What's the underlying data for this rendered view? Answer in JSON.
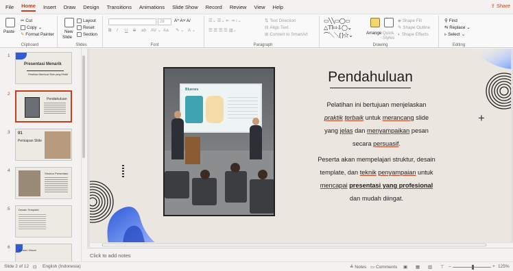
{
  "menu": {
    "items": [
      "File",
      "Home",
      "Insert",
      "Draw",
      "Design",
      "Transitions",
      "Animations",
      "Slide Show",
      "Record",
      "Review",
      "View",
      "Help"
    ],
    "active": "Home",
    "share": "Share"
  },
  "ribbon": {
    "clipboard": {
      "paste": "Paste",
      "cut": "Cut",
      "copy": "Copy",
      "format_painter": "Format Painter",
      "label": "Clipboard"
    },
    "slides": {
      "new_slide": "New",
      "new_slide2": "Slide",
      "layout": "Layout",
      "reset": "Reset",
      "section": "Section",
      "label": "Slides"
    },
    "font": {
      "size": "28",
      "label": "Font",
      "bold": "B",
      "italic": "I",
      "underline": "U",
      "strike": "S",
      "abc": "ab",
      "aa": "Aa"
    },
    "paragraph": {
      "text_direction": "Text Direction",
      "align_text": "Align Text",
      "smartart": "Convert to SmartArt",
      "label": "Paragraph"
    },
    "drawing": {
      "arrange": "Arrange",
      "quick_styles": "Quick",
      "quick_styles2": "Styles",
      "shape_fill": "Shape Fill",
      "shape_outline": "Shape Outline",
      "shape_effects": "Shape Effects",
      "label": "Drawing"
    },
    "editing": {
      "find": "Find",
      "replace": "Replace",
      "select": "Select",
      "label": "Editing"
    }
  },
  "thumbnails": [
    {
      "num": "1",
      "title": "Presentasi Menarik",
      "subtitle": "Pelatihan Membuat Slide yang Efektif"
    },
    {
      "num": "2",
      "title": "Pendahuluan",
      "selected": true
    },
    {
      "num": "3",
      "title": "Persiapan Slide",
      "tag": "01"
    },
    {
      "num": "4",
      "title": "Struktur Presentasi"
    },
    {
      "num": "5",
      "title": "Desain Template"
    },
    {
      "num": "6",
      "title": "Elemen Visual"
    }
  ],
  "slide": {
    "title": "Pendahuluan",
    "para1": {
      "part1": "Pelatihan ini bertujuan menjelaskan",
      "w_praktik": "praktik",
      "w_terbaik": "terbaik",
      "part2": "untuk",
      "w_merancang": "merancang",
      "part3": "slide",
      "part4": "yang",
      "w_jelas": "jelas",
      "part5": "dan",
      "w_menyampaikan": "menyampaikan",
      "part6": "pesan",
      "part7": "secara",
      "w_persuasif": "persuasif",
      "end": "."
    },
    "para2": {
      "part1": "Peserta akan mempelajari struktur,",
      "part2": "desain template, dan",
      "w_teknik": "teknik",
      "w_penyampaian": "penyampaian",
      "part3": "untuk",
      "w_mencapai": "mencapai",
      "w_bold": "presentasi yang profesional",
      "part4": "dan",
      "part5": "mudah diingat."
    },
    "photo_brand": "Bluenes"
  },
  "notes_placeholder": "Click to add notes",
  "status": {
    "slide_info": "Slide 2 of 12",
    "language": "English (Indonesia)",
    "notes": "Notes",
    "comments": "Comments",
    "zoom": "125%"
  }
}
